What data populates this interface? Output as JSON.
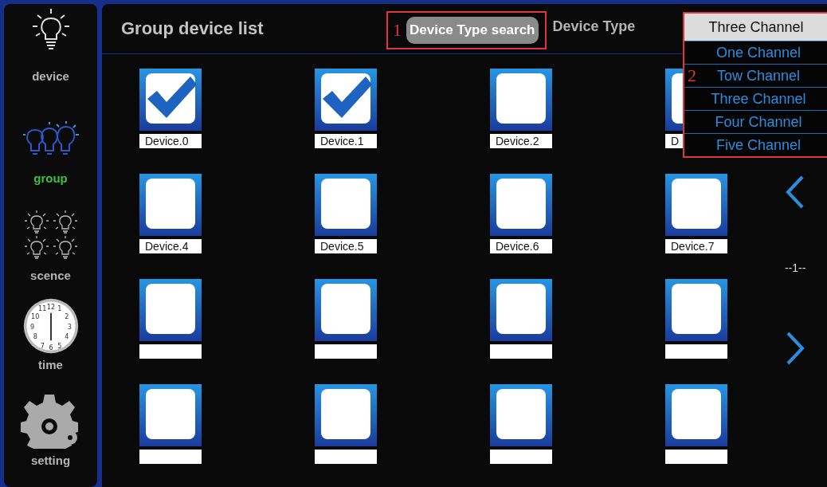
{
  "sidebar": {
    "items": [
      {
        "kind": "bulb",
        "label": "device",
        "selected": false
      },
      {
        "kind": "bulbs",
        "label": "group",
        "selected": true
      },
      {
        "kind": "bulb-grid",
        "label": "scence",
        "selected": false
      },
      {
        "kind": "clock",
        "label": "time",
        "selected": false,
        "numerals": [
          "11",
          "12",
          "1",
          "10",
          "2",
          "9",
          "3",
          "8",
          "4",
          "7",
          "6",
          "5"
        ]
      },
      {
        "kind": "gear",
        "label": "setting",
        "selected": false
      }
    ]
  },
  "header": {
    "title": "Group device list",
    "search_button": "Device Type search",
    "device_type_label": "Device Type",
    "annotation": "1"
  },
  "dropdown": {
    "value": "Three Channel",
    "annotation": "2",
    "options": [
      {
        "label": "One Channel"
      },
      {
        "label": "Tow Channel"
      },
      {
        "label": "Three Channel"
      },
      {
        "label": "Four Channel"
      },
      {
        "label": "Five Channel"
      }
    ]
  },
  "devices": [
    {
      "label": "Device.0",
      "checked": true
    },
    {
      "label": "Device.1",
      "checked": true
    },
    {
      "label": "Device.2",
      "checked": false
    },
    {
      "label": "D",
      "checked": false
    },
    {
      "label": "Device.4",
      "checked": false
    },
    {
      "label": "Device.5",
      "checked": false
    },
    {
      "label": "Device.6",
      "checked": false
    },
    {
      "label": "Device.7",
      "checked": false
    },
    {
      "checked": false
    },
    {
      "checked": false
    },
    {
      "checked": false
    },
    {
      "checked": false
    },
    {
      "checked": false
    },
    {
      "checked": false
    },
    {
      "checked": false
    },
    {
      "checked": false
    }
  ],
  "pager": {
    "page": "--1--"
  }
}
